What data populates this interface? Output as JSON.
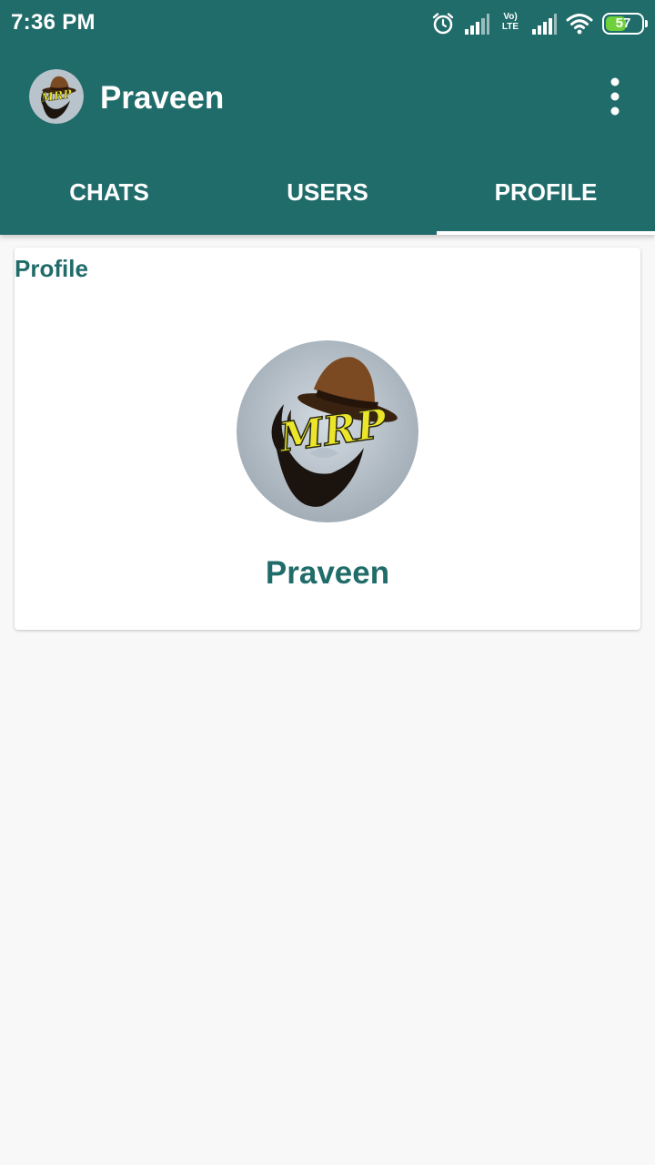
{
  "status_bar": {
    "time": "7:36 PM",
    "volte_label": "Vo) LTE",
    "battery_level": "57",
    "icons": [
      "alarm-icon",
      "signal-icon",
      "volte-icon",
      "signal-icon",
      "wifi-icon",
      "battery-icon"
    ]
  },
  "toolbar": {
    "title": "Praveen",
    "avatar_icon": "mrp-logo-avatar",
    "menu_icon": "more-vert-icon"
  },
  "tabs": [
    {
      "label": "CHATS",
      "selected": false
    },
    {
      "label": "USERS",
      "selected": false
    },
    {
      "label": "PROFILE",
      "selected": true
    }
  ],
  "profile": {
    "heading": "Profile",
    "name": "Praveen",
    "avatar_logo_text": "MRP"
  },
  "colors": {
    "primary": "#206c6a",
    "tab_indicator": "#ffffff",
    "background": "#f8f8f8",
    "card": "#ffffff",
    "battery_fill": "#6ed03a"
  }
}
